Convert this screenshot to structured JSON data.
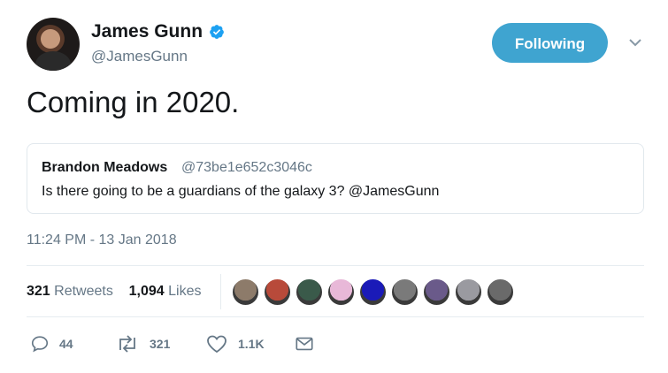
{
  "author": {
    "display_name": "James Gunn",
    "handle": "@JamesGunn",
    "verified": true
  },
  "follow_button": {
    "label": "Following",
    "color": "#3fa4d0"
  },
  "tweet": {
    "text": "Coming in 2020.",
    "timestamp": "11:24 PM - 13 Jan 2018"
  },
  "quoted_tweet": {
    "display_name": "Brandon Meadows",
    "handle": "@73be1e652c3046c",
    "text": "Is there going to be a guardians of the galaxy 3? @JamesGunn"
  },
  "stats": {
    "retweets_count": "321",
    "retweets_label": "Retweets",
    "likes_count": "1,094",
    "likes_label": "Likes"
  },
  "likers": [
    "#8d7b6a",
    "#b84a3a",
    "#3a5a4a",
    "#e8b8d8",
    "#1a1ab8",
    "#7a7a7a",
    "#6a5a8a",
    "#9a9aa0",
    "#6a6a6a"
  ],
  "actions": {
    "reply": {
      "icon": "reply-icon",
      "count": "44"
    },
    "retweet": {
      "icon": "retweet-icon",
      "count": "321"
    },
    "like": {
      "icon": "heart-icon",
      "count": "1.1K"
    },
    "message": {
      "icon": "envelope-icon"
    }
  },
  "colors": {
    "accent": "#1da1f2",
    "muted": "#657786",
    "text": "#14171a"
  }
}
